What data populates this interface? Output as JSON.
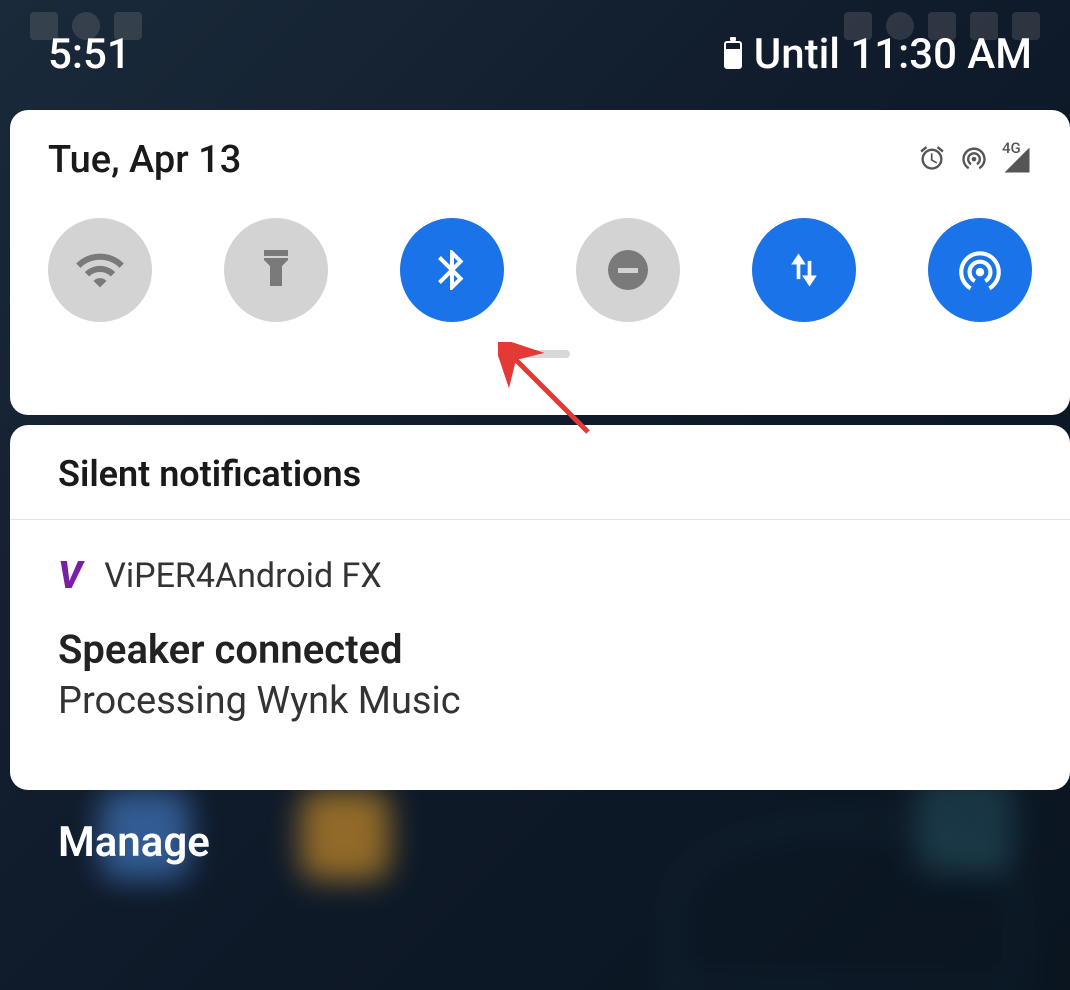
{
  "statusbar": {
    "time": "5:51",
    "battery_text": "Until 11:30 AM"
  },
  "quick_settings": {
    "date": "Tue, Apr 13",
    "network_label": "4G",
    "tiles": [
      {
        "name": "wifi",
        "active": false
      },
      {
        "name": "flashlight",
        "active": false
      },
      {
        "name": "bluetooth",
        "active": true
      },
      {
        "name": "dnd",
        "active": false
      },
      {
        "name": "mobile-data",
        "active": true
      },
      {
        "name": "hotspot",
        "active": true
      }
    ]
  },
  "notifications": {
    "section_title": "Silent notifications",
    "items": [
      {
        "app": "ViPER4Android FX",
        "title": "Speaker connected",
        "text": "Processing Wynk Music"
      }
    ]
  },
  "footer": {
    "manage_label": "Manage"
  },
  "colors": {
    "accent": "#1a73e8",
    "tile_off": "#d3d3d3",
    "annotation": "#e53935"
  }
}
